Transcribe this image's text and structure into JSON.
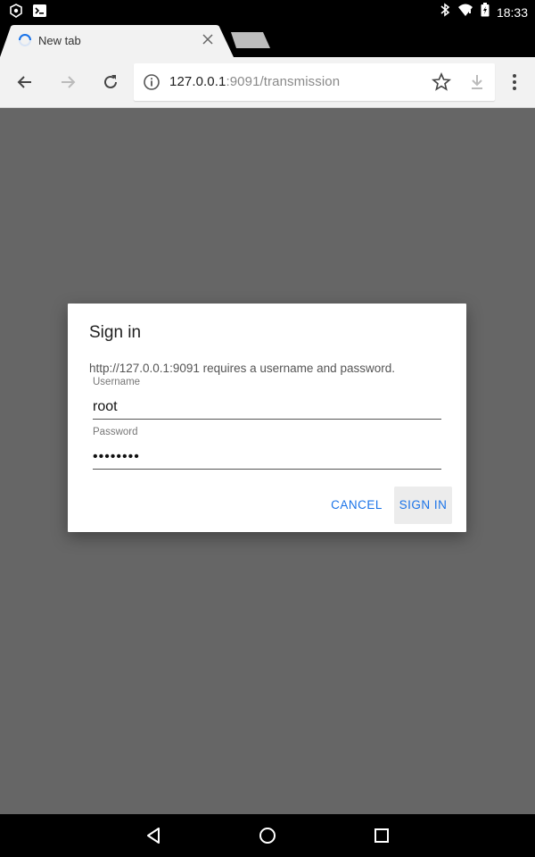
{
  "status_bar": {
    "time": "18:33",
    "icons": [
      "shield-notification-icon",
      "terminal-icon",
      "bluetooth-icon",
      "wifi-icon",
      "battery-charging-icon"
    ]
  },
  "tab": {
    "title": "New tab",
    "loading": true
  },
  "toolbar": {
    "url_host": "127.0.0.1",
    "url_rest": ":9091/transmission"
  },
  "dialog": {
    "title": "Sign in",
    "message": "http://127.0.0.1:9091 requires a username and password.",
    "username_label": "Username",
    "username_value": "root",
    "password_label": "Password",
    "password_value": "••••••••",
    "cancel_label": "CANCEL",
    "signin_label": "SIGN IN"
  },
  "colors": {
    "accent": "#1a73e8",
    "scrim": "#666666"
  }
}
